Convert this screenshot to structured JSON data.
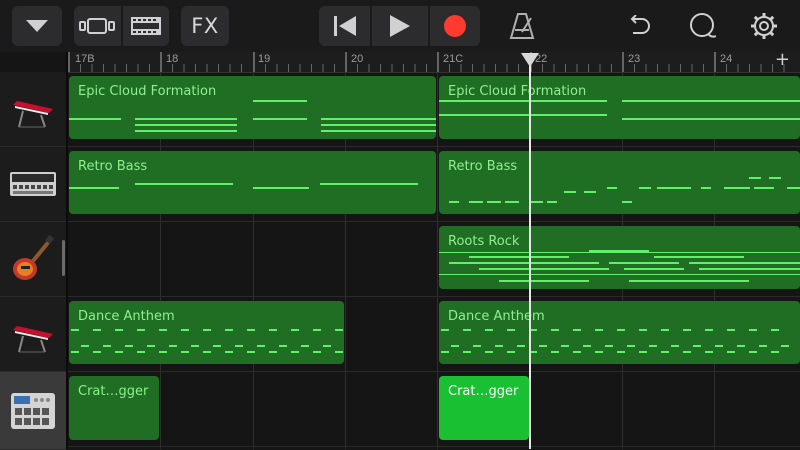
{
  "toolbar": {
    "fx_label": "FX",
    "icons": [
      "chevron-down-icon",
      "tracks-view-icon",
      "mixer-icon",
      "rewind-icon",
      "play-icon",
      "record-icon",
      "metronome-icon",
      "undo-icon",
      "loop-icon",
      "settings-icon"
    ],
    "record_color": "#ff3b30"
  },
  "ruler": {
    "markers": [
      "17B",
      "18",
      "19",
      "20",
      "21C",
      "22",
      "23",
      "24"
    ],
    "add_label": "+"
  },
  "tracks": [
    {
      "instrument": "keyboard-icon",
      "regions": [
        {
          "name": "Epic Cloud Formation"
        },
        {
          "name": "Epic Cloud Formation"
        }
      ]
    },
    {
      "instrument": "drum-machine-icon",
      "regions": [
        {
          "name": "Retro Bass"
        },
        {
          "name": "Retro Bass"
        }
      ]
    },
    {
      "instrument": "electric-guitar-icon",
      "regions": [
        {
          "name": "Roots Rock"
        }
      ]
    },
    {
      "instrument": "keyboard-icon",
      "regions": [
        {
          "name": "Dance Anthem"
        },
        {
          "name": "Dance Anthem"
        }
      ]
    },
    {
      "instrument": "beat-sequencer-icon",
      "regions": [
        {
          "name": "Crat…gger"
        },
        {
          "name": "Crat…gger"
        }
      ]
    }
  ],
  "colors": {
    "region": "#1f6e24",
    "region_selected": "#19c032",
    "note": "#62f06a",
    "region_text": "#8ef08e"
  }
}
